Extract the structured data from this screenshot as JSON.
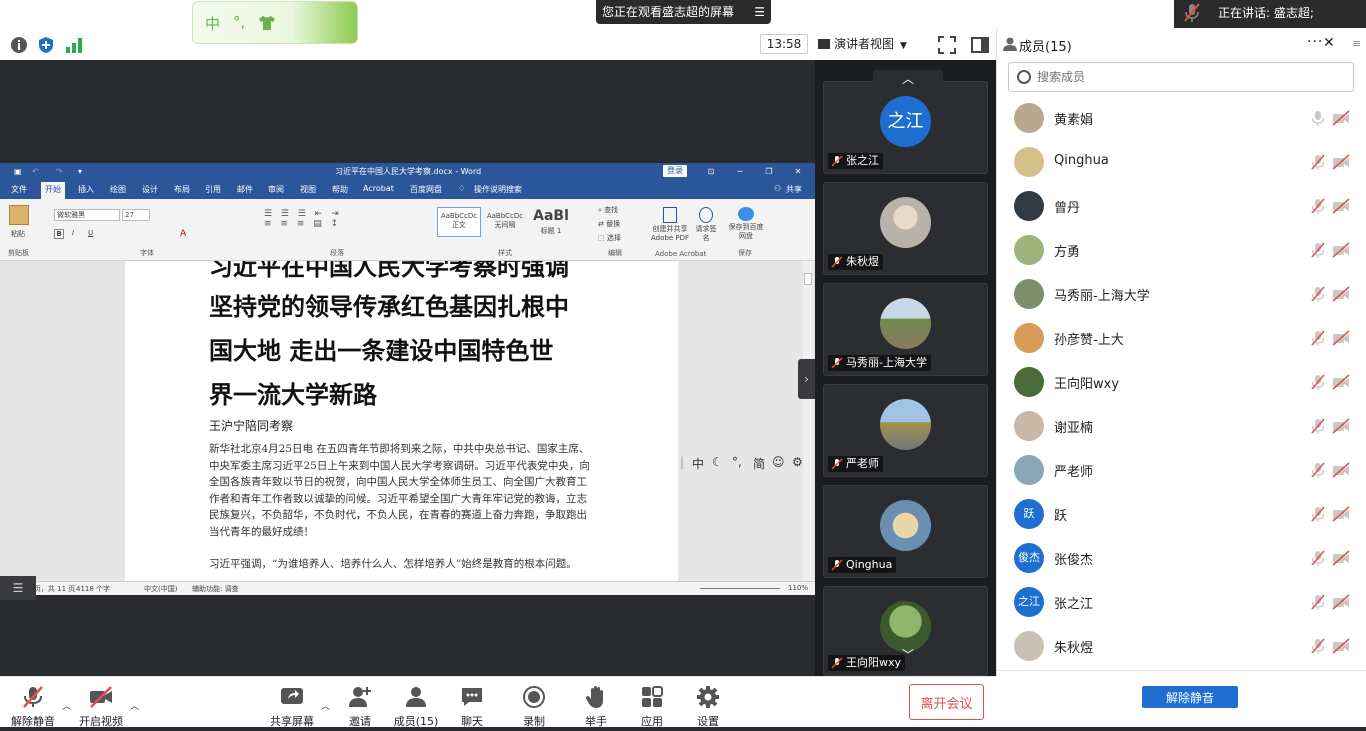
{
  "top": {
    "ime_bar": {
      "mode": "中",
      "punct": "°,",
      "skin_icon": "shirt-icon"
    },
    "share_banner": "您正在观看盛志超的屏幕",
    "speaking": "正在讲话: 盛志超;",
    "time": "13:58",
    "view_mode": "演讲者视图"
  },
  "word": {
    "title": "习近平在中国人民大学考察.docx - Word",
    "login": "登录",
    "menu": [
      "文件",
      "开始",
      "插入",
      "绘图",
      "设计",
      "布局",
      "引用",
      "邮件",
      "审阅",
      "视图",
      "帮助",
      "Acrobat",
      "百度网盘",
      "操作说明搜索"
    ],
    "share": "共享",
    "ribbon": {
      "paste": "粘贴",
      "clipboard": "剪贴板",
      "font_name": "微软雅黑",
      "font_size": "27",
      "font_group": "字体",
      "paragraph_group": "段落",
      "style_group": "样式",
      "styles": [
        "正文",
        "无间隔",
        "标题 1"
      ],
      "style_previews": [
        "AaBbCcDc",
        "AaBbCcDc",
        "AaBl"
      ],
      "find": "查找",
      "replace": "替换",
      "select": "选择",
      "edit_group": "编辑",
      "acrobat_btn1": "创建并共享 Adobe PDF",
      "acrobat_btn2": "请求签名",
      "acrobat_group": "Adobe Acrobat",
      "save_baidu": "保存到百度网盘",
      "save_group": "保存"
    },
    "doc": {
      "heading_lines": [
        "习近平在中国人民大学考察时强调",
        "坚持党的领导传承红色基因扎根中",
        "国大地  走出一条建设中国特色世",
        "界一流大学新路"
      ],
      "subtitle": "王沪宁陪同考察",
      "para1": "新华社北京4月25日电  在五四青年节即将到来之际，中共中央总书记、国家主席、中央军委主席习近平25日上午来到中国人民大学考察调研。习近平代表党中央，向全国各族青年致以节日的祝贺，向中国人民大学全体师生员工、向全国广大教育工作者和青年工作者致以诚挚的问候。习近平希望全国广大青年牢记党的教诲，立志民族复兴，不负韶华，不负时代，不负人民，在青春的赛道上奋力奔跑，争取跑出当代青年的最好成绩！",
      "para2": "习近平强调，“为谁培养人、培养什么人、怎样培养人”始终是教育的根本问题。"
    },
    "ime_float": [
      "中",
      "☾",
      "°,",
      "简",
      "☺",
      "⚙"
    ],
    "status": {
      "pages": "第 1 页，共 11 页",
      "words": "4118 个字",
      "lang": "中文(中国)",
      "accessibility": "辅助功能: 调查",
      "zoom": "110%"
    }
  },
  "videos": [
    {
      "name": "张之江",
      "avatar_text": "之江",
      "color": "#1f6fd1"
    },
    {
      "name": "朱秋煜",
      "avatar_text": "",
      "color": "#c9c1b5"
    },
    {
      "name": "马秀丽-上海大学",
      "avatar_text": "",
      "color": "#7d8f6a"
    },
    {
      "name": "严老师",
      "avatar_text": "",
      "color": "#8aa7b8"
    },
    {
      "name": "Qinghua",
      "avatar_text": "",
      "color": "#d6c08a"
    },
    {
      "name": "王向阳wxy",
      "avatar_text": "",
      "color": "#4a6b3a"
    }
  ],
  "members": {
    "title": "成员(15)",
    "search_placeholder": "搜索成员",
    "list": [
      {
        "name": "黄素娟",
        "avatar_text": "",
        "color": "#b7a98e",
        "muted": false
      },
      {
        "name": "Qinghua",
        "avatar_text": "",
        "color": "#d6c08a",
        "muted": true
      },
      {
        "name": "曾丹",
        "avatar_text": "",
        "color": "#2f3a44",
        "muted": true
      },
      {
        "name": "方勇",
        "avatar_text": "",
        "color": "#9db37a",
        "muted": true
      },
      {
        "name": "马秀丽-上海大学",
        "avatar_text": "",
        "color": "#7d8f6a",
        "muted": true
      },
      {
        "name": "孙彦赞-上大",
        "avatar_text": "",
        "color": "#d79b5a",
        "muted": true
      },
      {
        "name": "王向阳wxy",
        "avatar_text": "",
        "color": "#4a6b3a",
        "muted": true
      },
      {
        "name": "谢亚楠",
        "avatar_text": "",
        "color": "#c8b8a6",
        "muted": true
      },
      {
        "name": "严老师",
        "avatar_text": "",
        "color": "#8aa7b8",
        "muted": true
      },
      {
        "name": "跃",
        "avatar_text": "跃",
        "color": "#1f6fd1",
        "muted": true
      },
      {
        "name": "张俊杰",
        "avatar_text": "俊杰",
        "color": "#1f6fd1",
        "muted": true
      },
      {
        "name": "张之江",
        "avatar_text": "之江",
        "color": "#1f6fd1",
        "muted": true
      },
      {
        "name": "朱秋煜",
        "avatar_text": "",
        "color": "#c9c1b5",
        "muted": true
      }
    ],
    "unmute_all": "解除静音"
  },
  "toolbar": {
    "unmute": "解除静音",
    "start_video": "开启视频",
    "share_screen": "共享屏幕",
    "invite": "邀请",
    "members": "成员(15)",
    "chat": "聊天",
    "record": "录制",
    "raise_hand": "举手",
    "apps": "应用",
    "settings": "设置",
    "leave": "离开会议"
  }
}
